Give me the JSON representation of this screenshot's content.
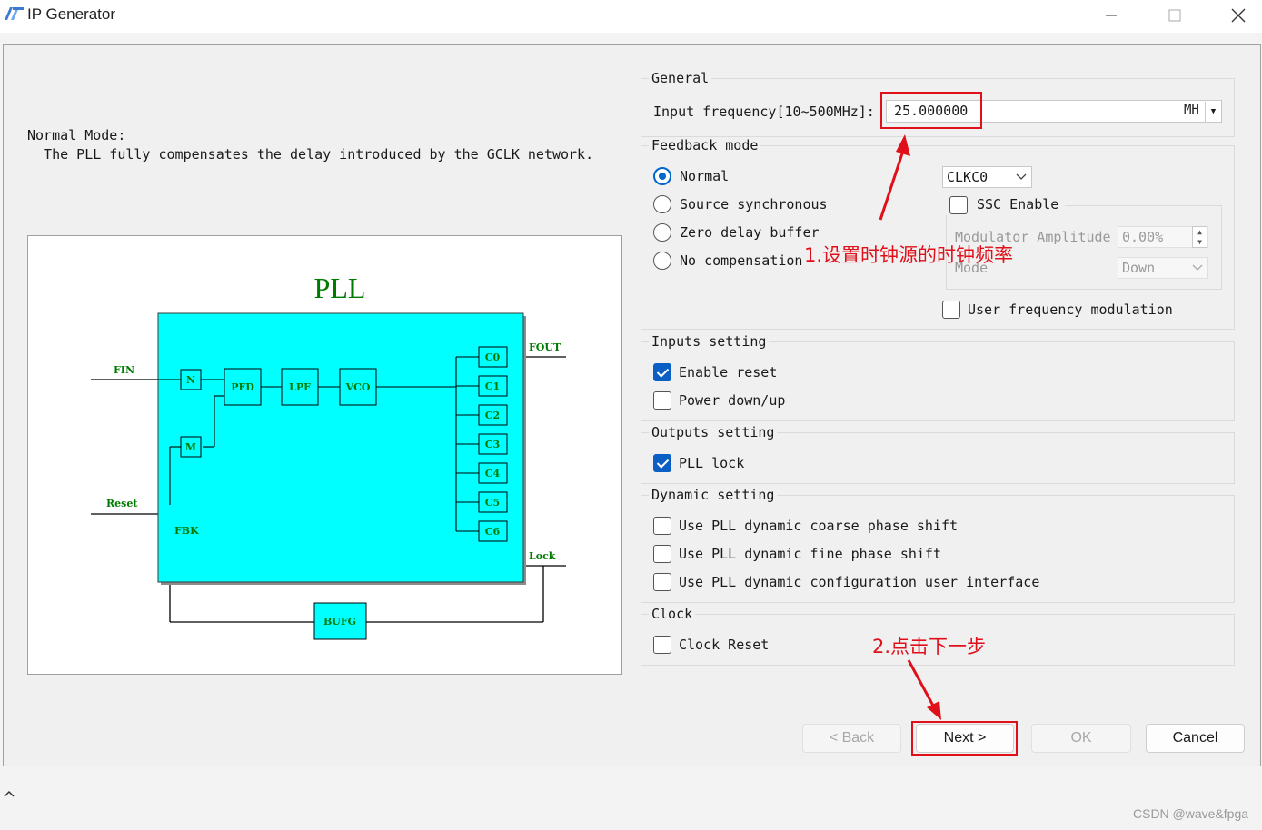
{
  "window": {
    "title": "IP Generator",
    "controls": [
      "minimize",
      "maximize",
      "close"
    ]
  },
  "description": {
    "mode_label": "Normal Mode:",
    "mode_text": "  The PLL fully compensates the delay introduced by the GCLK network."
  },
  "diagram": {
    "title": "PLL",
    "pins": {
      "fin": "FIN",
      "reset": "Reset",
      "fbk": "FBK",
      "fout": "FOUT",
      "lock": "Lock"
    },
    "blocks": {
      "n": "N",
      "m": "M",
      "pfd": "PFD",
      "lpf": "LPF",
      "vco": "VCO",
      "bufg": "BUFG"
    },
    "outputs": [
      "C0",
      "C1",
      "C2",
      "C3",
      "C4",
      "C5",
      "C6"
    ],
    "colors": {
      "pll_body": "#00ffff",
      "label_green": "#007a00"
    }
  },
  "general": {
    "title": "General",
    "freq_label": "Input frequency[10~500MHz]:",
    "freq_value": "25.000000",
    "freq_unit": "MH"
  },
  "feedback": {
    "title": "Feedback mode",
    "options": [
      "Normal",
      "Source synchronous",
      "Zero delay buffer",
      "No compensation"
    ],
    "selected": "Normal",
    "clk_select": "CLKC0",
    "ssc_label": "SSC Enable",
    "mod_amp_label": "Modulator Amplitude",
    "mod_amp_value": "0.00%",
    "mode_label": "Mode",
    "mode_value": "Down",
    "user_freq_label": "User frequency modulation"
  },
  "inputs": {
    "title": "Inputs setting",
    "enable_reset": "Enable reset",
    "power_down": "Power down/up"
  },
  "outputs": {
    "title": "Outputs setting",
    "pll_lock": "PLL lock"
  },
  "dynamic": {
    "title": "Dynamic setting",
    "coarse": "Use PLL dynamic coarse phase shift",
    "fine": "Use PLL dynamic fine phase shift",
    "config": "Use PLL dynamic configuration user interface"
  },
  "clock": {
    "title": "Clock",
    "reset": "Clock Reset"
  },
  "buttons": {
    "back": "< Back",
    "next": "Next >",
    "ok": "OK",
    "cancel": "Cancel"
  },
  "annotations": {
    "step1": "1.设置时钟源的时钟频率",
    "step2": "2.点击下一步",
    "color": "#e0101a"
  },
  "watermark": "CSDN @wave&fpga"
}
